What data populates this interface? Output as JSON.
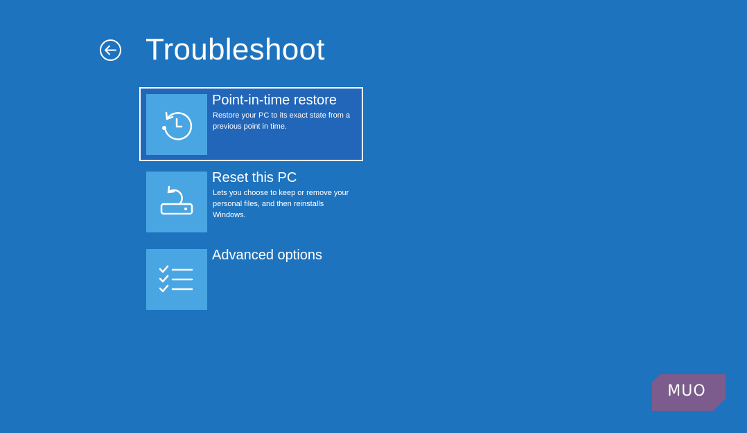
{
  "header": {
    "title": "Troubleshoot",
    "back_icon": "back-arrow-icon"
  },
  "options": [
    {
      "title": "Point-in-time restore",
      "description": "Restore your PC to its exact state from a previous point in time.",
      "icon": "restore-clock-icon",
      "selected": true
    },
    {
      "title": "Reset this PC",
      "description": "Lets you choose to keep or remove your personal files, and then reinstalls Windows.",
      "icon": "reset-pc-icon",
      "selected": false
    },
    {
      "title": "Advanced options",
      "description": "",
      "icon": "checklist-icon",
      "selected": false
    }
  ],
  "watermark": {
    "text": "MUO"
  },
  "colors": {
    "background": "#1e73be",
    "tile": "#4aa6e2",
    "selected_background": "#2166b8",
    "logo": "#7b5c8c"
  }
}
